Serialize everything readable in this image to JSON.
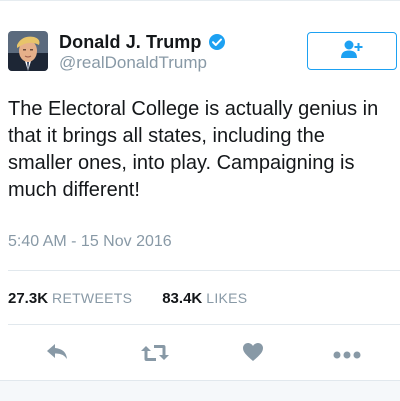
{
  "tweet": {
    "author": {
      "display_name": "Donald J. Trump",
      "handle": "@realDonaldTrump",
      "verified": true
    },
    "text": "The Electoral College is actually genius in that it brings all states, including the smaller ones, into play. Campaigning is much different!",
    "timestamp": "5:40 AM - 15 Nov 2016",
    "stats": {
      "retweets_count": "27.3K",
      "retweets_label": "RETWEETS",
      "likes_count": "83.4K",
      "likes_label": "LIKES"
    }
  },
  "icons": {
    "follow": "add-user-icon",
    "verified": "verified-badge-icon",
    "reply": "reply-icon",
    "retweet": "retweet-icon",
    "like": "heart-icon",
    "more": "more-icon"
  },
  "colors": {
    "brand_blue": "#1da1f2",
    "text": "#14171a",
    "muted": "#8899a6",
    "action_icon": "#8899a6"
  }
}
